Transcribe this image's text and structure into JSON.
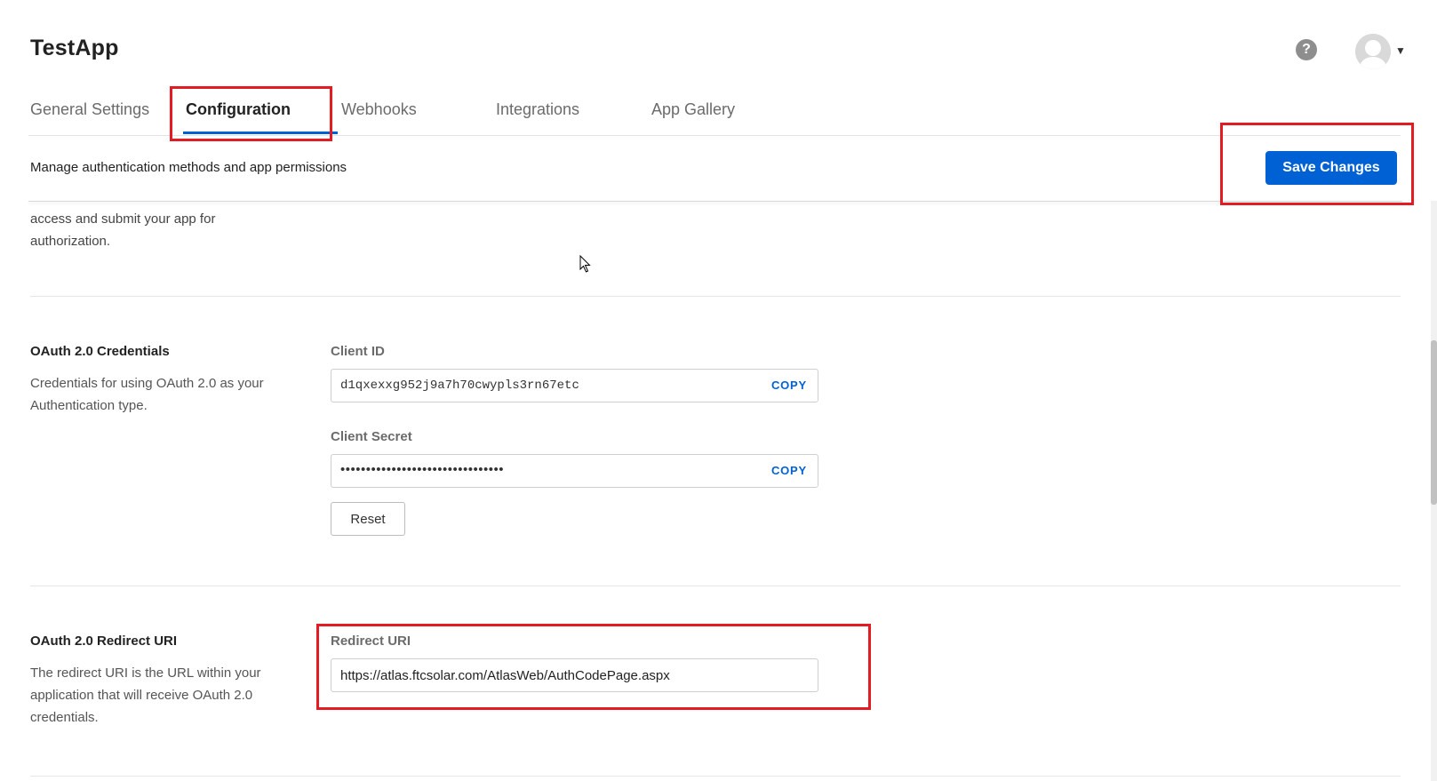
{
  "app": {
    "title": "TestApp",
    "help_icon_glyph": "?"
  },
  "tabs": [
    {
      "label": "General Settings",
      "active": false
    },
    {
      "label": "Configuration",
      "active": true
    },
    {
      "label": "Webhooks",
      "active": false
    },
    {
      "label": "Integrations",
      "active": false
    },
    {
      "label": "App Gallery",
      "active": false
    }
  ],
  "subheader": {
    "text": "Manage authentication methods and app permissions",
    "save_label": "Save Changes"
  },
  "partial_section": {
    "desc": "access and submit your app for authorization."
  },
  "oauth_credentials": {
    "title": "OAuth 2.0 Credentials",
    "desc": "Credentials for using OAuth 2.0 as your Authentication type.",
    "client_id_label": "Client ID",
    "client_id_value": "d1qxexxg952j9a7h70cwypls3rn67etc",
    "client_secret_label": "Client Secret",
    "client_secret_value": "••••••••••••••••••••••••••••••••",
    "copy_label": "COPY",
    "reset_label": "Reset"
  },
  "redirect": {
    "title": "OAuth 2.0 Redirect URI",
    "desc": "The redirect URI is the URL within your application that will receive OAuth 2.0 credentials.",
    "label": "Redirect URI",
    "value": "https://atlas.ftcsolar.com/AtlasWeb/AuthCodePage.aspx"
  },
  "colors": {
    "accent": "#0061d5",
    "highlight": "#e31b23"
  }
}
